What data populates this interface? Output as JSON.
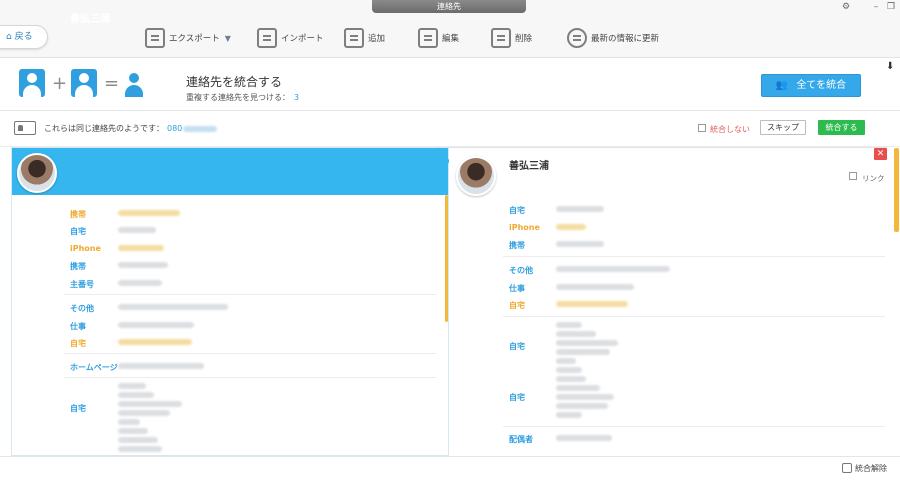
{
  "window": {
    "title": "連絡先"
  },
  "toolbar": {
    "back_label": "戻る",
    "export_label": "エクスポート",
    "import_label": "インポート",
    "add_label": "追加",
    "edit_label": "編集",
    "delete_label": "削除",
    "refresh_label": "最新の情報に更新"
  },
  "merge": {
    "title": "連絡先を統合する",
    "duplicates_label": "重複する連絡先を見つける：",
    "duplicates_count": "3",
    "merge_all_label": "全てを統合"
  },
  "group": {
    "same_contact_label": "これらは同じ連絡先のようです：",
    "phone_prefix": "080",
    "no_merge_label": "統合しない",
    "skip_label": "スキップ",
    "merge_label": "統合する"
  },
  "left_contact": {
    "name": "善弘三浦",
    "fields": [
      {
        "label": "携帯",
        "color": "orange"
      },
      {
        "label": "自宅",
        "color": "blue"
      },
      {
        "label": "iPhone",
        "color": "orange"
      },
      {
        "label": "携帯",
        "color": "blue"
      },
      {
        "label": "主番号",
        "color": "blue"
      },
      {
        "label": "その他",
        "color": "blue"
      },
      {
        "label": "仕事",
        "color": "blue"
      },
      {
        "label": "自宅",
        "color": "orange"
      },
      {
        "label": "ホームページ",
        "color": "blue"
      },
      {
        "label": "自宅",
        "color": "blue"
      }
    ]
  },
  "right_contact": {
    "name": "善弘三浦",
    "link_label": "リンク",
    "fields": [
      {
        "label": "自宅",
        "color": "blue"
      },
      {
        "label": "iPhone",
        "color": "orange"
      },
      {
        "label": "携帯",
        "color": "blue"
      },
      {
        "label": "その他",
        "color": "blue"
      },
      {
        "label": "仕事",
        "color": "blue"
      },
      {
        "label": "自宅",
        "color": "orange"
      },
      {
        "label": "自宅",
        "color": "blue"
      },
      {
        "label": "自宅",
        "color": "blue"
      },
      {
        "label": "配偶者",
        "color": "blue"
      }
    ]
  },
  "footer": {
    "unmerge_label": "統合解除"
  },
  "colors": {
    "accent": "#35b6ee",
    "primary_button": "#35a8ea",
    "merge_green": "#2dbb4f",
    "orange": "#f0a830",
    "red": "#e94e4e"
  }
}
